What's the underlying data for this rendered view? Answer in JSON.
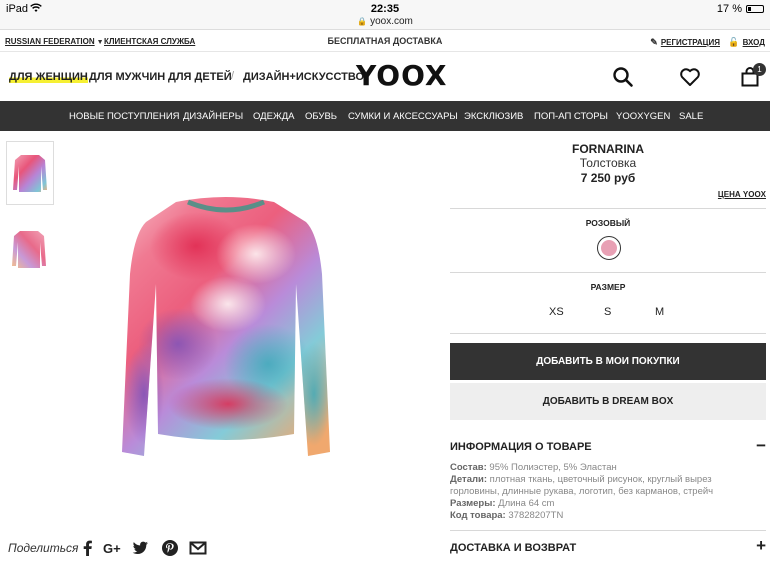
{
  "status_bar": {
    "device": "iPad",
    "time": "22:35",
    "url": "yoox.com",
    "battery": "17 %"
  },
  "utility": {
    "country": "RUSSIAN FEDERATION",
    "customer_service": "КЛИЕНТСКАЯ СЛУЖБА",
    "promo": "БЕСПЛАТНАЯ ДОСТАВКА",
    "register": "РЕГИСТРАЦИЯ",
    "login": "ВХОД"
  },
  "header": {
    "categories": [
      "ДЛЯ ЖЕНЩИН",
      "ДЛЯ МУЖЧИН",
      "ДЛЯ ДЕТЕЙ",
      "ДИЗАЙН+ИСКУССТВО"
    ],
    "separator": "/",
    "logo": "YOOX",
    "bag_count": "1"
  },
  "nav": [
    "НОВЫЕ ПОСТУПЛЕНИЯ",
    "ДИЗАЙНЕРЫ",
    "ОДЕЖДА",
    "ОБУВЬ",
    "СУМКИ И АКСЕССУАРЫ",
    "ЭКСКЛЮЗИВ",
    "ПОП-АП СТОРЫ",
    "YOOXYGEN",
    "SALE"
  ],
  "share": {
    "label": "Поделиться"
  },
  "product": {
    "brand": "FORNARINA",
    "type": "Толстовка",
    "price": "7 250 руб",
    "yoox_price": "ЦЕНА YOOX",
    "color_name": "РОЗОВЫЙ",
    "swatch_color": "#e8a0b4",
    "size_label": "РАЗМЕР",
    "sizes": [
      "XS",
      "S",
      "M"
    ],
    "add_to_cart": "ДОБАВИТЬ В МОИ ПОКУПКИ",
    "add_to_dreambox": "ДОБАВИТЬ В DREAM BOX"
  },
  "info": {
    "title": "ИНФОРМАЦИЯ О ТОВАРЕ",
    "toggle": "−",
    "composition_label": "Состав:",
    "composition": "95% Полиэстер, 5% Эластан",
    "details_label": "Детали:",
    "details_1": "плотная ткань, цветочный рисунок, круглый вырез",
    "details_2": "горловины, длинные рукава, логотип, без карманов, стрейч",
    "sizes_label": "Размеры:",
    "sizes": "Длина 64 cm",
    "code_label": "Код товара:",
    "code": "37828207TN"
  },
  "delivery": {
    "title": "ДОСТАВКА И ВОЗВРАТ",
    "toggle": "+"
  }
}
